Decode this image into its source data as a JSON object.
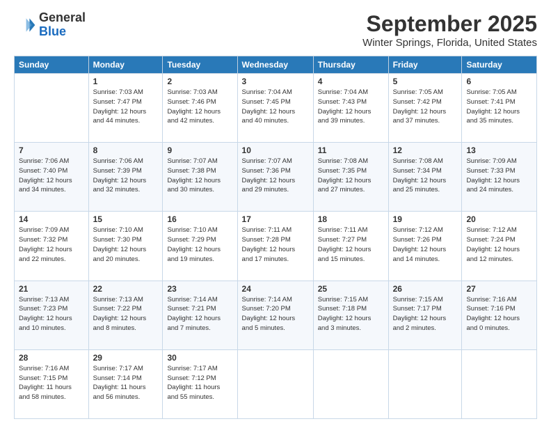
{
  "logo": {
    "general": "General",
    "blue": "Blue"
  },
  "header": {
    "month": "September 2025",
    "location": "Winter Springs, Florida, United States"
  },
  "weekdays": [
    "Sunday",
    "Monday",
    "Tuesday",
    "Wednesday",
    "Thursday",
    "Friday",
    "Saturday"
  ],
  "weeks": [
    [
      {
        "day": "",
        "info": ""
      },
      {
        "day": "1",
        "info": "Sunrise: 7:03 AM\nSunset: 7:47 PM\nDaylight: 12 hours\nand 44 minutes."
      },
      {
        "day": "2",
        "info": "Sunrise: 7:03 AM\nSunset: 7:46 PM\nDaylight: 12 hours\nand 42 minutes."
      },
      {
        "day": "3",
        "info": "Sunrise: 7:04 AM\nSunset: 7:45 PM\nDaylight: 12 hours\nand 40 minutes."
      },
      {
        "day": "4",
        "info": "Sunrise: 7:04 AM\nSunset: 7:43 PM\nDaylight: 12 hours\nand 39 minutes."
      },
      {
        "day": "5",
        "info": "Sunrise: 7:05 AM\nSunset: 7:42 PM\nDaylight: 12 hours\nand 37 minutes."
      },
      {
        "day": "6",
        "info": "Sunrise: 7:05 AM\nSunset: 7:41 PM\nDaylight: 12 hours\nand 35 minutes."
      }
    ],
    [
      {
        "day": "7",
        "info": "Sunrise: 7:06 AM\nSunset: 7:40 PM\nDaylight: 12 hours\nand 34 minutes."
      },
      {
        "day": "8",
        "info": "Sunrise: 7:06 AM\nSunset: 7:39 PM\nDaylight: 12 hours\nand 32 minutes."
      },
      {
        "day": "9",
        "info": "Sunrise: 7:07 AM\nSunset: 7:38 PM\nDaylight: 12 hours\nand 30 minutes."
      },
      {
        "day": "10",
        "info": "Sunrise: 7:07 AM\nSunset: 7:36 PM\nDaylight: 12 hours\nand 29 minutes."
      },
      {
        "day": "11",
        "info": "Sunrise: 7:08 AM\nSunset: 7:35 PM\nDaylight: 12 hours\nand 27 minutes."
      },
      {
        "day": "12",
        "info": "Sunrise: 7:08 AM\nSunset: 7:34 PM\nDaylight: 12 hours\nand 25 minutes."
      },
      {
        "day": "13",
        "info": "Sunrise: 7:09 AM\nSunset: 7:33 PM\nDaylight: 12 hours\nand 24 minutes."
      }
    ],
    [
      {
        "day": "14",
        "info": "Sunrise: 7:09 AM\nSunset: 7:32 PM\nDaylight: 12 hours\nand 22 minutes."
      },
      {
        "day": "15",
        "info": "Sunrise: 7:10 AM\nSunset: 7:30 PM\nDaylight: 12 hours\nand 20 minutes."
      },
      {
        "day": "16",
        "info": "Sunrise: 7:10 AM\nSunset: 7:29 PM\nDaylight: 12 hours\nand 19 minutes."
      },
      {
        "day": "17",
        "info": "Sunrise: 7:11 AM\nSunset: 7:28 PM\nDaylight: 12 hours\nand 17 minutes."
      },
      {
        "day": "18",
        "info": "Sunrise: 7:11 AM\nSunset: 7:27 PM\nDaylight: 12 hours\nand 15 minutes."
      },
      {
        "day": "19",
        "info": "Sunrise: 7:12 AM\nSunset: 7:26 PM\nDaylight: 12 hours\nand 14 minutes."
      },
      {
        "day": "20",
        "info": "Sunrise: 7:12 AM\nSunset: 7:24 PM\nDaylight: 12 hours\nand 12 minutes."
      }
    ],
    [
      {
        "day": "21",
        "info": "Sunrise: 7:13 AM\nSunset: 7:23 PM\nDaylight: 12 hours\nand 10 minutes."
      },
      {
        "day": "22",
        "info": "Sunrise: 7:13 AM\nSunset: 7:22 PM\nDaylight: 12 hours\nand 8 minutes."
      },
      {
        "day": "23",
        "info": "Sunrise: 7:14 AM\nSunset: 7:21 PM\nDaylight: 12 hours\nand 7 minutes."
      },
      {
        "day": "24",
        "info": "Sunrise: 7:14 AM\nSunset: 7:20 PM\nDaylight: 12 hours\nand 5 minutes."
      },
      {
        "day": "25",
        "info": "Sunrise: 7:15 AM\nSunset: 7:18 PM\nDaylight: 12 hours\nand 3 minutes."
      },
      {
        "day": "26",
        "info": "Sunrise: 7:15 AM\nSunset: 7:17 PM\nDaylight: 12 hours\nand 2 minutes."
      },
      {
        "day": "27",
        "info": "Sunrise: 7:16 AM\nSunset: 7:16 PM\nDaylight: 12 hours\nand 0 minutes."
      }
    ],
    [
      {
        "day": "28",
        "info": "Sunrise: 7:16 AM\nSunset: 7:15 PM\nDaylight: 11 hours\nand 58 minutes."
      },
      {
        "day": "29",
        "info": "Sunrise: 7:17 AM\nSunset: 7:14 PM\nDaylight: 11 hours\nand 56 minutes."
      },
      {
        "day": "30",
        "info": "Sunrise: 7:17 AM\nSunset: 7:12 PM\nDaylight: 11 hours\nand 55 minutes."
      },
      {
        "day": "",
        "info": ""
      },
      {
        "day": "",
        "info": ""
      },
      {
        "day": "",
        "info": ""
      },
      {
        "day": "",
        "info": ""
      }
    ]
  ]
}
